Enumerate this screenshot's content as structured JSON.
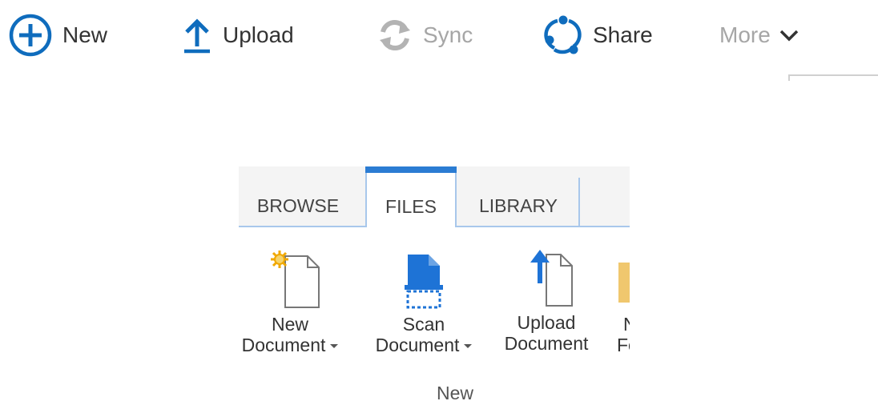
{
  "command_bar": {
    "new_label": "New",
    "upload_label": "Upload",
    "sync_label": "Sync",
    "share_label": "Share",
    "more_label": "More"
  },
  "ribbon": {
    "tabs": [
      {
        "label": "BROWSE",
        "active": false
      },
      {
        "label": "FILES",
        "active": true
      },
      {
        "label": "LIBRARY",
        "active": false
      }
    ],
    "buttons": {
      "new_document": {
        "line1": "New",
        "line2": "Document"
      },
      "scan_document": {
        "line1": "Scan",
        "line2": "Document"
      },
      "upload_document": {
        "line1": "Upload",
        "line2": "Document"
      },
      "new_folder_partial": {
        "line1": "N",
        "line2": "Fo"
      }
    },
    "group_label": "New"
  },
  "colors": {
    "accent": "#0f6cbd",
    "tab_accent": "#2b7cd3",
    "disabled": "#a6a6a6",
    "folder": "#f0c76e"
  }
}
